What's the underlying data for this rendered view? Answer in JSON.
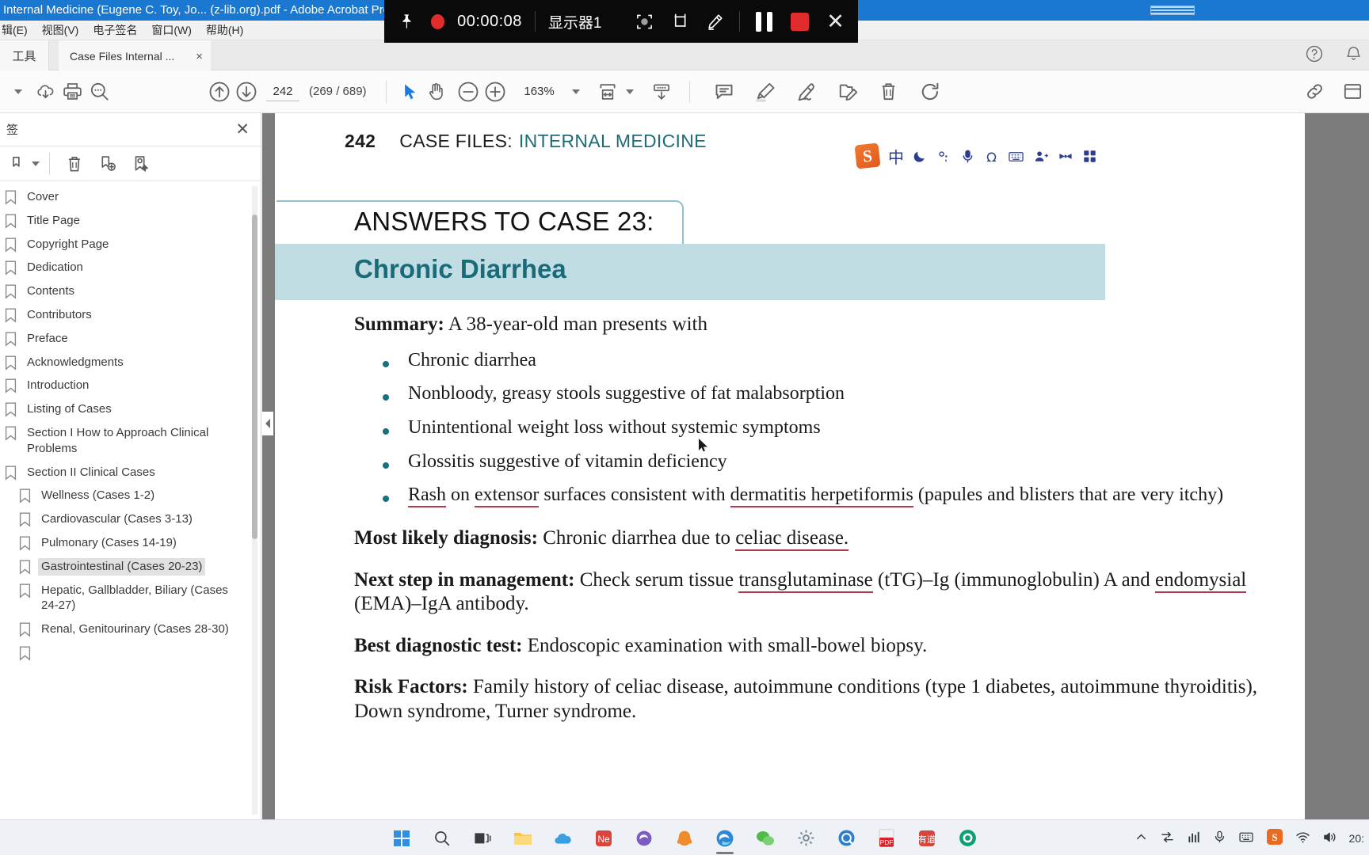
{
  "window": {
    "title": "Internal Medicine (Eugene C. Toy, Jo... (z-lib.org).pdf - Adobe Acrobat Pro"
  },
  "menubar": {
    "items": [
      "辑(E)",
      "视图(V)",
      "电子签名",
      "窗口(W)",
      "帮助(H)"
    ]
  },
  "tabstrip": {
    "tools_label": "工具",
    "tab_label": "Case Files Internal ...",
    "tab_close": "×",
    "help_icon": "question-circle-icon",
    "bell_icon": "bell-icon"
  },
  "toolbar": {
    "page_value": "242",
    "page_count": "(269 / 689)",
    "zoom_value": "163%",
    "icons": [
      "save-cloud-icon",
      "print-icon",
      "search-icon",
      "previous-page-icon",
      "next-page-icon",
      "select-tool-icon",
      "hand-tool-icon",
      "zoom-out-icon",
      "zoom-in-icon",
      "fit-page-icon",
      "form-fill-icon",
      "comment-icon",
      "highlight-icon",
      "sign-icon",
      "edit-pdf-icon",
      "delete-icon",
      "rotate-icon",
      "link-icon",
      "more-icon"
    ]
  },
  "sidebar": {
    "panel_title": "签",
    "close_label": "✕",
    "toolbar_icons": [
      "options-dropdown-icon",
      "delete-bookmark-icon",
      "new-bookmark-icon",
      "find-bookmark-icon"
    ],
    "bookmarks": [
      {
        "label": "Cover",
        "indent": 0,
        "selected": false
      },
      {
        "label": "Title Page",
        "indent": 0,
        "selected": false
      },
      {
        "label": "Copyright Page",
        "indent": 0,
        "selected": false
      },
      {
        "label": "Dedication",
        "indent": 0,
        "selected": false
      },
      {
        "label": "Contents",
        "indent": 0,
        "selected": false
      },
      {
        "label": "Contributors",
        "indent": 0,
        "selected": false
      },
      {
        "label": "Preface",
        "indent": 0,
        "selected": false
      },
      {
        "label": "Acknowledgments",
        "indent": 0,
        "selected": false
      },
      {
        "label": "Introduction",
        "indent": 0,
        "selected": false
      },
      {
        "label": "Listing of Cases",
        "indent": 0,
        "selected": false
      },
      {
        "label": "Section I How to Approach Clinical Problems",
        "indent": 0,
        "selected": false
      },
      {
        "label": "Section II Clinical Cases",
        "indent": 0,
        "selected": false
      },
      {
        "label": "Wellness (Cases 1-2)",
        "indent": 1,
        "selected": false
      },
      {
        "label": "Cardiovascular (Cases 3-13)",
        "indent": 1,
        "selected": false
      },
      {
        "label": "Pulmonary (Cases 14-19)",
        "indent": 1,
        "selected": false
      },
      {
        "label": "Gastrointestinal (Cases 20-23)",
        "indent": 1,
        "selected": true
      },
      {
        "label": "Hepatic, Gallbladder, Biliary (Cases 24-27)",
        "indent": 1,
        "selected": false
      },
      {
        "label": "Renal, Genitourinary (Cases 28-30)",
        "indent": 1,
        "selected": false
      }
    ]
  },
  "document": {
    "page_number": "242",
    "running_head_black": "CASE FILES:",
    "running_head_teal": "INTERNAL MEDICINE",
    "answers_heading": "ANSWERS TO CASE 23:",
    "case_title": "Chronic Diarrhea",
    "summary_label": "Summary:",
    "summary_text": " A 38-year-old man presents with",
    "bullets": [
      "Chronic diarrhea",
      "Nonbloody, greasy stools suggestive of fat malabsorption",
      "Unintentional weight loss without systemic symptoms",
      "Glossitis suggestive of vitamin deficiency"
    ],
    "bullet_rash": {
      "u1": "Rash",
      "t1": " on ",
      "u2": "extensor",
      "t2": " surfaces consistent with ",
      "u3": "dermatitis herpetiformis",
      "t3": " (papules and blisters that are very itchy)"
    },
    "diagnosis_label": "Most likely diagnosis:",
    "diagnosis_text": " Chronic diarrhea due to ",
    "diagnosis_underlined": "celiac disease.",
    "next_step_label": "Next step in management:",
    "next_step_t1": " Check serum tissue ",
    "next_step_u1": "transglutaminase",
    "next_step_t2": " (tTG)–Ig (immunoglobulin) A and ",
    "next_step_u2": "endomysial",
    "next_step_t3": " (EMA)–IgA antibody.",
    "best_test_label": "Best diagnostic test:",
    "best_test_text": " Endoscopic examination with small-bowel biopsy.",
    "risk_label": "Risk Factors:",
    "risk_text": " Family history of celiac disease, autoimmune conditions (type 1 diabetes, autoimmune thyroiditis), Down syndrome, Turner syndrome."
  },
  "ime": {
    "logo": "S",
    "buttons": [
      "中",
      "moon-icon",
      "weather-icon",
      "microphone-icon",
      "omega-symbol-icon",
      "keyboard-icon",
      "user-icon",
      "bowtie-icon",
      "apps-grid-icon"
    ],
    "mode_label": "中"
  },
  "recorder": {
    "pin_icon": "pin-icon",
    "record_dot": "record-dot-icon",
    "elapsed": "00:00:08",
    "monitor_label": "显示器1",
    "icons": [
      "capture-region-icon",
      "crop-icon",
      "pen-icon"
    ],
    "pause_icon": "pause-icon",
    "stop_icon": "stop-icon",
    "close_icon": "close-icon"
  },
  "taskbar": {
    "apps": [
      "windows-start-icon",
      "search-icon",
      "task-view-icon",
      "file-explorer-icon",
      "onedrive-icon",
      "netease-icon",
      "edge-dev-icon",
      "tim-icon",
      "edge-icon",
      "wechat-icon",
      "settings-icon",
      "sogou-search-icon",
      "acrobat-icon",
      "youdao-icon",
      "green-circle-icon"
    ],
    "tray": [
      "chevron-up-icon",
      "network-switch-icon",
      "volume-meter-icon",
      "microphone-icon",
      "ime-panel-icon",
      "sogou-icon",
      "wifi-icon",
      "speaker-icon",
      "battery-icon"
    ],
    "clock": "20:"
  },
  "colors": {
    "titlebar": "#1b78d0",
    "band": "#bfdde3",
    "teal": "#1b6a78",
    "underline": "#b03a4c",
    "record_red": "#e02c2c"
  }
}
